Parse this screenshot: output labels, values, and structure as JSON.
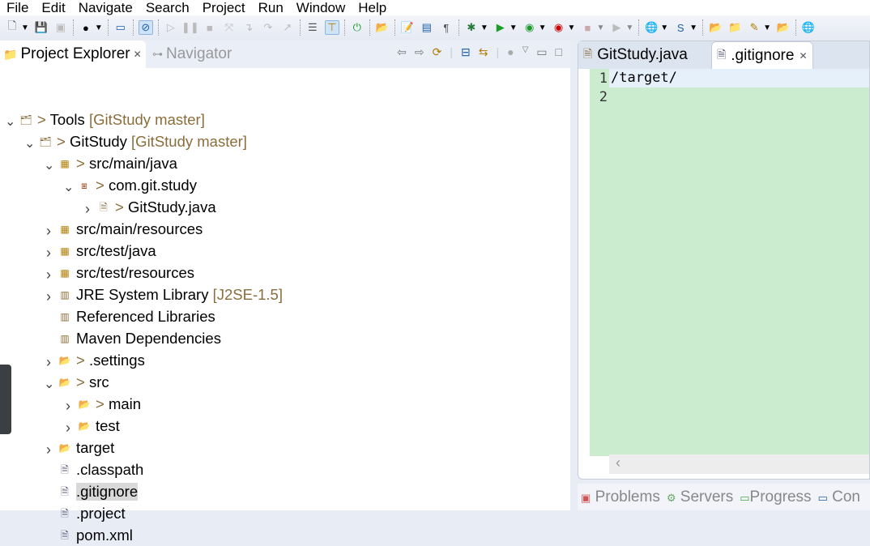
{
  "menu": [
    "File",
    "Edit",
    "Navigate",
    "Search",
    "Project",
    "Run",
    "Window",
    "Help"
  ],
  "left_tabs": {
    "project_explorer": "Project Explorer",
    "navigator": "Navigator"
  },
  "tree": [
    {
      "label": "Tools",
      "decor": "> ",
      "suffix": " [GitStudy master]",
      "level": 0,
      "arrow": "expanded"
    },
    {
      "label": "GitStudy",
      "decor": "> ",
      "suffix": " [GitStudy master]",
      "level": 1,
      "arrow": "expanded"
    },
    {
      "label": "src/main/java",
      "decor": "> ",
      "suffix": "",
      "level": 2,
      "arrow": "expanded"
    },
    {
      "label": "com.git.study",
      "decor": "> ",
      "suffix": "",
      "level": 3,
      "arrow": "expanded"
    },
    {
      "label": "GitStudy.java",
      "decor": "> ",
      "suffix": "",
      "level": 4,
      "arrow": "collapsed"
    },
    {
      "label": "src/main/resources",
      "decor": "",
      "suffix": "",
      "level": 2,
      "arrow": "collapsed"
    },
    {
      "label": "src/test/java",
      "decor": "",
      "suffix": "",
      "level": 2,
      "arrow": "collapsed"
    },
    {
      "label": "src/test/resources",
      "decor": "",
      "suffix": "",
      "level": 2,
      "arrow": "collapsed"
    },
    {
      "label": "JRE System Library",
      "decor": "",
      "suffix": " [J2SE-1.5]",
      "level": 2,
      "arrow": "collapsed"
    },
    {
      "label": "Referenced Libraries",
      "decor": "",
      "suffix": "",
      "level": 2,
      "arrow": "none"
    },
    {
      "label": "Maven Dependencies",
      "decor": "",
      "suffix": "",
      "level": 2,
      "arrow": "none"
    },
    {
      "label": ".settings",
      "decor": "> ",
      "suffix": "",
      "level": 2,
      "arrow": "collapsed"
    },
    {
      "label": "src",
      "decor": "> ",
      "suffix": "",
      "level": 2,
      "arrow": "expanded"
    },
    {
      "label": "main",
      "decor": "> ",
      "suffix": "",
      "level": 3,
      "arrow": "collapsed"
    },
    {
      "label": "test",
      "decor": "",
      "suffix": "",
      "level": 3,
      "arrow": "collapsed"
    },
    {
      "label": "target",
      "decor": "",
      "suffix": "",
      "level": 2,
      "arrow": "collapsed"
    },
    {
      "label": ".classpath",
      "decor": "",
      "suffix": "",
      "level": 2,
      "arrow": "none"
    },
    {
      "label": ".gitignore",
      "decor": "",
      "suffix": "",
      "level": 2,
      "arrow": "none",
      "selected": true
    },
    {
      "label": ".project",
      "decor": "",
      "suffix": "",
      "level": 2,
      "arrow": "none"
    },
    {
      "label": "pom.xml",
      "decor": "",
      "suffix": "",
      "level": 2,
      "arrow": "none"
    }
  ],
  "editor": {
    "tabs": [
      "GitStudy.java",
      ".gitignore"
    ],
    "active_tab": ".gitignore",
    "line_numbers": [
      "1",
      "2"
    ],
    "lines": [
      "/target/",
      ""
    ]
  },
  "bottom_tabs": [
    "Problems",
    "Servers",
    "Progress",
    "Con"
  ],
  "colors": {
    "editor_bg": "#cbeccf",
    "decorator": "#8a6d3b"
  }
}
